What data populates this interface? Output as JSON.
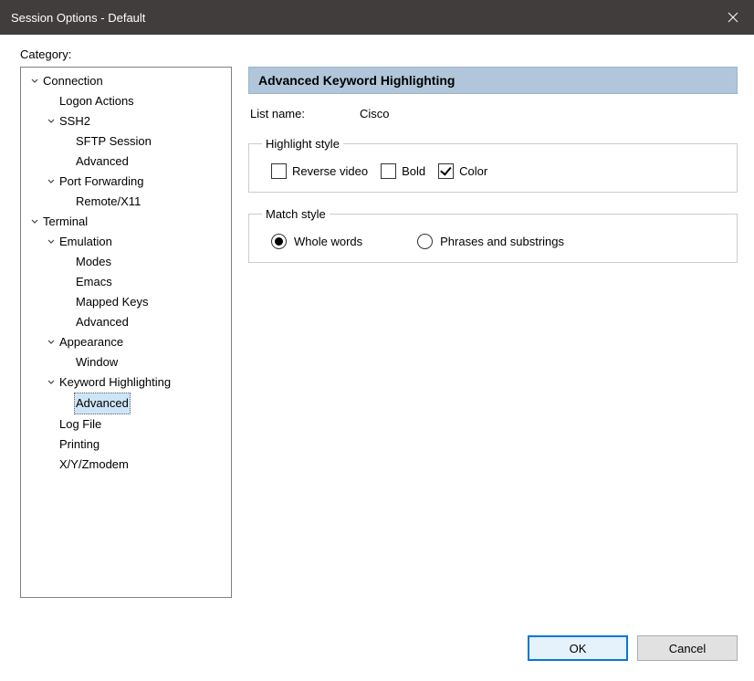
{
  "title": "Session Options - Default",
  "category_label": "Category:",
  "tree": [
    {
      "label": "Connection",
      "level": 0,
      "expanded": true
    },
    {
      "label": "Logon Actions",
      "level": 1,
      "leaf": true
    },
    {
      "label": "SSH2",
      "level": 1,
      "expanded": true
    },
    {
      "label": "SFTP Session",
      "level": 2,
      "leaf": true
    },
    {
      "label": "Advanced",
      "level": 2,
      "leaf": true
    },
    {
      "label": "Port Forwarding",
      "level": 1,
      "expanded": true
    },
    {
      "label": "Remote/X11",
      "level": 2,
      "leaf": true
    },
    {
      "label": "Terminal",
      "level": 0,
      "expanded": true
    },
    {
      "label": "Emulation",
      "level": 1,
      "expanded": true
    },
    {
      "label": "Modes",
      "level": 2,
      "leaf": true
    },
    {
      "label": "Emacs",
      "level": 2,
      "leaf": true
    },
    {
      "label": "Mapped Keys",
      "level": 2,
      "leaf": true
    },
    {
      "label": "Advanced",
      "level": 2,
      "leaf": true
    },
    {
      "label": "Appearance",
      "level": 1,
      "expanded": true
    },
    {
      "label": "Window",
      "level": 2,
      "leaf": true
    },
    {
      "label": "Keyword Highlighting",
      "level": 1,
      "expanded": true
    },
    {
      "label": "Advanced",
      "level": 2,
      "leaf": true,
      "selected": true
    },
    {
      "label": "Log File",
      "level": 1,
      "leaf": true
    },
    {
      "label": "Printing",
      "level": 1,
      "leaf": true
    },
    {
      "label": "X/Y/Zmodem",
      "level": 1,
      "leaf": true
    }
  ],
  "panel": {
    "header": "Advanced Keyword Highlighting",
    "list_name_label": "List name:",
    "list_name_value": "Cisco",
    "highlight_group_label": "Highlight style",
    "checks": [
      {
        "label": "Reverse video",
        "checked": false
      },
      {
        "label": "Bold",
        "checked": false
      },
      {
        "label": "Color",
        "checked": true
      }
    ],
    "match_group_label": "Match style",
    "radios": [
      {
        "label": "Whole words",
        "checked": true
      },
      {
        "label": "Phrases and substrings",
        "checked": false
      }
    ]
  },
  "buttons": {
    "ok": "OK",
    "cancel": "Cancel"
  }
}
